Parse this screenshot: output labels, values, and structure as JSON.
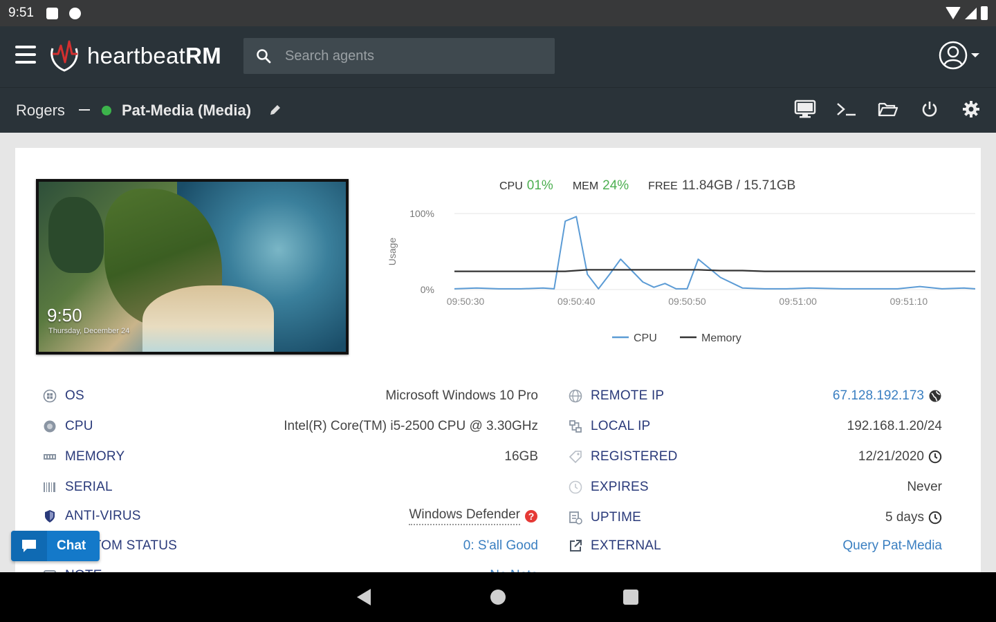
{
  "status_bar": {
    "time": "9:51"
  },
  "app": {
    "brand_regular": "heartbeat",
    "brand_bold": "RM"
  },
  "search": {
    "placeholder": "Search agents"
  },
  "breadcrumb": {
    "root": "Rogers",
    "agent": "Pat-Media (Media)",
    "status_color": "#3cb44b"
  },
  "toolbar": {
    "icons": [
      "desktop-icon",
      "terminal-icon",
      "folder-open-icon",
      "power-icon",
      "gear-icon"
    ]
  },
  "screenshot": {
    "time": "9:50",
    "date": "Thursday, December 24"
  },
  "stats": {
    "cpu_label": "CPU",
    "cpu_value": "01%",
    "mem_label": "MEM",
    "mem_value": "24%",
    "free_label": "FREE",
    "free_value": "11.84GB / 15.71GB"
  },
  "chart_data": {
    "type": "line",
    "ylabel": "Usage",
    "y_ticks": [
      "100%",
      "0%"
    ],
    "ylim": [
      0,
      100
    ],
    "x_ticks": [
      "09:50:30",
      "09:50:40",
      "09:50:50",
      "09:51:00",
      "09:51:10"
    ],
    "x": [
      0,
      2,
      4,
      6,
      8,
      9,
      10,
      11,
      12,
      13,
      14,
      15,
      16,
      17,
      18,
      19,
      20,
      21,
      22,
      24,
      26,
      28,
      30,
      32,
      35,
      40,
      42,
      44,
      46,
      47
    ],
    "series": [
      {
        "name": "CPU",
        "color": "#5b9bd5",
        "values": [
          1,
          2,
          1,
          1,
          2,
          1,
          90,
          96,
          20,
          1,
          20,
          40,
          25,
          10,
          3,
          8,
          1,
          1,
          40,
          16,
          2,
          1,
          1,
          2,
          1,
          1,
          4,
          1,
          2,
          1
        ]
      },
      {
        "name": "Memory",
        "color": "#333333",
        "values": [
          24,
          24,
          24,
          24,
          24,
          24,
          24,
          25,
          26,
          26,
          26,
          26,
          26,
          26,
          26,
          26,
          26,
          26,
          26,
          25,
          25,
          24,
          24,
          24,
          24,
          24,
          24,
          24,
          24,
          24
        ]
      }
    ],
    "legend_position": "bottom"
  },
  "left_info": [
    {
      "label": "OS",
      "value": "Microsoft Windows 10 Pro",
      "icon": "windows-icon"
    },
    {
      "label": "CPU",
      "value": "Intel(R) Core(TM) i5-2500 CPU @ 3.30GHz",
      "icon": "cpu-icon"
    },
    {
      "label": "MEMORY",
      "value": "16GB",
      "icon": "memory-icon"
    },
    {
      "label": "SERIAL",
      "value": "",
      "icon": "barcode-icon"
    },
    {
      "label": "ANTI-VIRUS",
      "value": "Windows Defender",
      "icon": "shield-icon"
    },
    {
      "label": "CUSTOM STATUS",
      "value": "0: S'all Good",
      "icon": "status-icon"
    },
    {
      "label": "NOTE",
      "value": "No Note",
      "icon": "note-icon"
    }
  ],
  "right_info": [
    {
      "label": "REMOTE IP",
      "value": "67.128.192.173",
      "icon": "globe-icon"
    },
    {
      "label": "LOCAL IP",
      "value": "192.168.1.20/24",
      "icon": "network-icon"
    },
    {
      "label": "REGISTERED",
      "value": "12/21/2020",
      "icon": "tag-icon"
    },
    {
      "label": "EXPIRES",
      "value": "Never",
      "icon": "clock-icon"
    },
    {
      "label": "UPTIME",
      "value": "5 days",
      "icon": "uptime-icon"
    },
    {
      "label": "EXTERNAL",
      "value": "Query Pat-Media",
      "icon": "external-link-icon"
    }
  ],
  "chat": {
    "label": "Chat"
  }
}
